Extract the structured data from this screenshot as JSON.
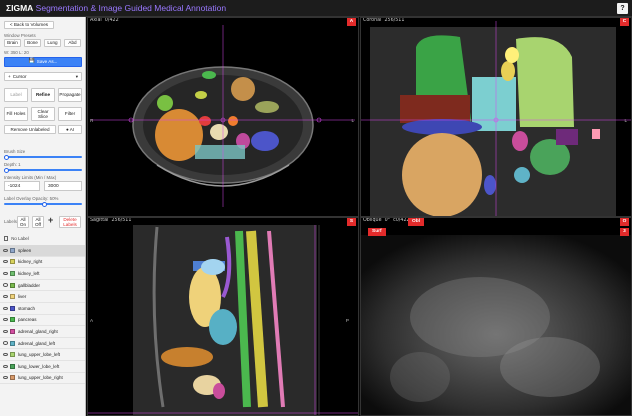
{
  "app": {
    "title_sigma": "ΣIGMA",
    "title_rest": "Segmentation & Image Guided Medical Annotation",
    "help": "?"
  },
  "sidebar": {
    "back": "< Back to Volumes",
    "window_presets_label": "Window Presets",
    "presets": [
      "Brain",
      "Bone",
      "Lung",
      "Abd"
    ],
    "wl_readout": "W: 350 L: 20",
    "save_as": "Save As...",
    "tool_select": "Cursor",
    "tools_row1": [
      "Label",
      "Refine",
      "Propagate"
    ],
    "tools_row2": [
      "Fill Holes",
      "Clear Slice",
      "Filter"
    ],
    "remove_unlabeled": "Remove Unlabeled",
    "ai": "AI",
    "brush_size_label": "Brush Size",
    "depth_label": "Depth: 1",
    "intensity_label": "Intensity Limits (Min / Max)",
    "intensity_min": "-1024",
    "intensity_max": "3000",
    "overlay_opacity_label": "Label Overlay Opacity: 50%",
    "labels_label": "Labels",
    "all_on": "All On",
    "all_off": "All Off",
    "delete_labels": "Delete Labels",
    "no_label": "No Label",
    "labels": [
      {
        "name": "spleen",
        "color": "#8fa6c9"
      },
      {
        "name": "kidney_right",
        "color": "#d8d25c"
      },
      {
        "name": "kidney_left",
        "color": "#6fbf6f"
      },
      {
        "name": "gallbladder",
        "color": "#79b94d"
      },
      {
        "name": "liver",
        "color": "#efd27a"
      },
      {
        "name": "stomach",
        "color": "#4c55c9"
      },
      {
        "name": "pancreas",
        "color": "#4bb84e"
      },
      {
        "name": "adrenal_gland_right",
        "color": "#d34ea0"
      },
      {
        "name": "adrenal_gland_left",
        "color": "#5fb3c7"
      },
      {
        "name": "lung_upper_lobe_left",
        "color": "#a8d46f"
      },
      {
        "name": "lung_lower_lobe_left",
        "color": "#4aa35a"
      },
      {
        "name": "lung_upper_lobe_right",
        "color": "#d89a6a"
      }
    ]
  },
  "views": {
    "axial": {
      "label": "Axial",
      "slice": "0/422",
      "badge": "A",
      "left": "R",
      "right": "L"
    },
    "coronal": {
      "label": "Coronal",
      "slice": "256/511",
      "badge": "C",
      "right": "L"
    },
    "sagittal": {
      "label": "Sagittal",
      "slice": "256/511",
      "badge": "S",
      "left": "A",
      "right": "P"
    },
    "oblique": {
      "label": "Oblique",
      "angle": "0°",
      "slice": "c0/422",
      "obl": "Obl",
      "surf": "Surf",
      "badge": "O",
      "badge2": "3"
    }
  },
  "colors": {
    "accent": "#3b82f6",
    "badge": "#e32b2b",
    "title": "#9a78ff",
    "crosshair": "#d946ef"
  }
}
